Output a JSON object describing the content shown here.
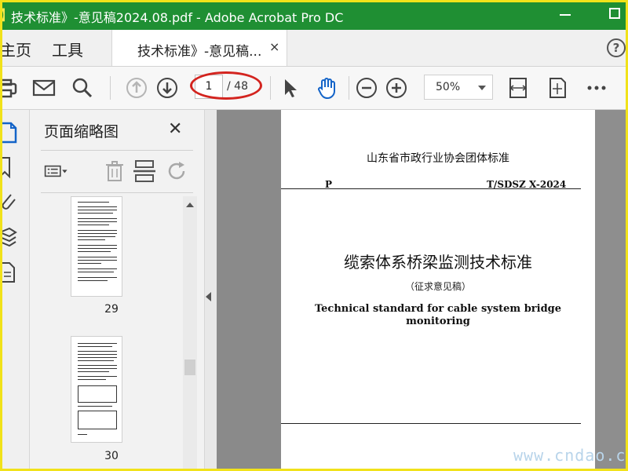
{
  "window": {
    "title": "技术标准》-意见稿2024.08.pdf - Adobe Acrobat Pro DC"
  },
  "nav": {
    "home": "主页",
    "tools": "工具"
  },
  "tab": {
    "label": "技术标准》-意见稿...",
    "close": "×"
  },
  "help": {
    "label": "?"
  },
  "toolbar": {
    "current_page": "1",
    "total_pages": "/ 48",
    "zoom": "50%"
  },
  "panel": {
    "title": "页面缩略图",
    "close": "✕",
    "thumbnails": [
      {
        "page": "29"
      },
      {
        "page": "30"
      }
    ]
  },
  "document": {
    "organization": "山东省市政行业协会团体标准",
    "marker": "P",
    "code": "T/SDSZ X-2024",
    "title_cn": "缆索体系桥梁监测技术标准",
    "subtitle": "（征求意见稿）",
    "title_en_line1": "Technical standard for cable system bridge",
    "title_en_line2": "monitoring"
  },
  "watermark": {
    "text": "www.cndao.c"
  },
  "colors": {
    "titlebar": "#1f8f33",
    "accent_blue": "#1464c8",
    "annotation_red": "#d3241f"
  },
  "icons": [
    "print-icon",
    "mail-icon",
    "search-icon",
    "prev-page-icon",
    "next-page-icon",
    "select-pointer-icon",
    "hand-tool-icon",
    "zoom-out-icon",
    "zoom-in-icon",
    "fit-page-icon",
    "full-screen-icon",
    "more-icon"
  ]
}
